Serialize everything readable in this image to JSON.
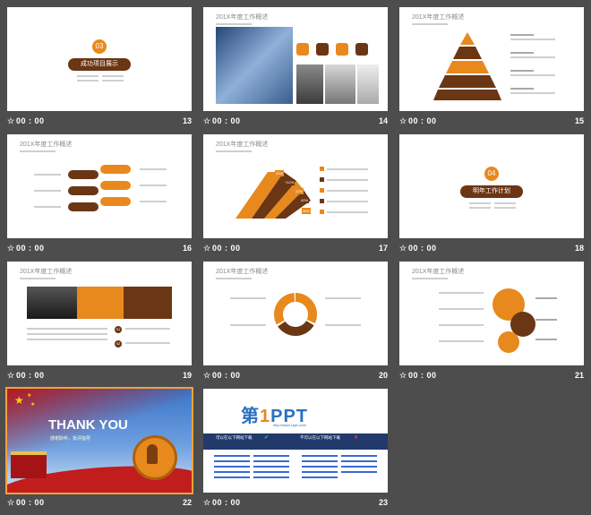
{
  "colors": {
    "background": "#4d4d4d",
    "brown": "#6b3614",
    "orange": "#e8891e",
    "selected_outline": "#f0a23c"
  },
  "slides": [
    {
      "num": "13",
      "time": "00 : 00",
      "kind": "section",
      "badge": "03",
      "heading": "成功项目展示"
    },
    {
      "num": "14",
      "time": "00 : 00",
      "kind": "content",
      "title": "201X年度工作概述"
    },
    {
      "num": "15",
      "time": "00 : 00",
      "kind": "content",
      "title": "201X年度工作概述"
    },
    {
      "num": "16",
      "time": "00 : 00",
      "kind": "content",
      "title": "201X年度工作概述"
    },
    {
      "num": "17",
      "time": "00 : 00",
      "kind": "content",
      "title": "201X年度工作概述",
      "percents": [
        "32%",
        "+12%",
        "22%",
        "42%",
        "45%"
      ]
    },
    {
      "num": "18",
      "time": "00 : 00",
      "kind": "section",
      "badge": "04",
      "heading": "明年工作计划"
    },
    {
      "num": "19",
      "time": "00 : 00",
      "kind": "content",
      "title": "201X年度工作概述",
      "badges": [
        "01",
        "02"
      ]
    },
    {
      "num": "20",
      "time": "00 : 00",
      "kind": "content",
      "title": "201X年度工作概述"
    },
    {
      "num": "21",
      "time": "00 : 00",
      "kind": "content",
      "title": "201X年度工作概述"
    },
    {
      "num": "22",
      "time": "00 : 00",
      "kind": "thankyou",
      "title": "THANK YOU",
      "subtitle": "感谢聆听，批评指导"
    },
    {
      "num": "23",
      "time": "00 : 00",
      "kind": "ppt",
      "logo_a": "第",
      "logo_b": "1",
      "logo_c": "PPT",
      "url": "http://www.1ppt.com/",
      "left_header": "可以在以下网站下载",
      "right_header": "不可以在以下网站下载"
    }
  ]
}
